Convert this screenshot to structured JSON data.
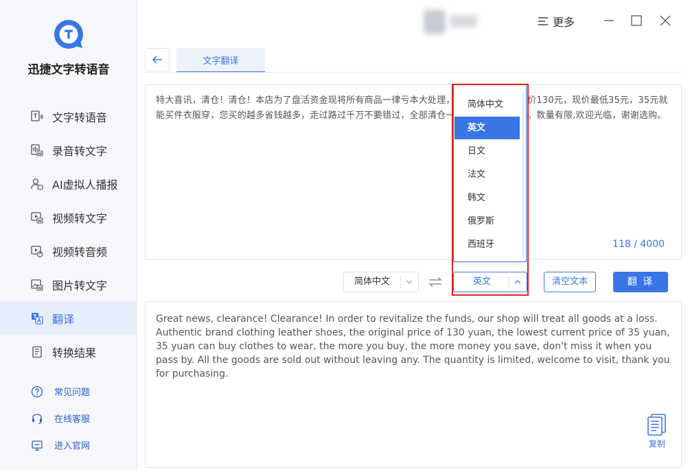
{
  "app": {
    "name": "迅捷文字转语音",
    "brand_color": "#3a75e5",
    "logo_icon": "app-logo-icon"
  },
  "sidebar": {
    "items": [
      {
        "label": "文字转语音",
        "icon": "text-to-speech-icon"
      },
      {
        "label": "录音转文字",
        "icon": "audio-to-text-icon"
      },
      {
        "label": "AI虚拟人播报",
        "icon": "virtual-anchor-icon"
      },
      {
        "label": "视频转文字",
        "icon": "video-to-text-icon"
      },
      {
        "label": "视频转音频",
        "icon": "video-to-audio-icon"
      },
      {
        "label": "图片转文字",
        "icon": "image-to-text-icon"
      },
      {
        "label": "翻译",
        "icon": "translate-icon",
        "active": true
      },
      {
        "label": "转换结果",
        "icon": "results-icon"
      }
    ],
    "help": [
      {
        "label": "常见问题",
        "icon": "question-icon"
      },
      {
        "label": "在线客服",
        "icon": "headset-icon"
      },
      {
        "label": "进入官网",
        "icon": "monitor-icon"
      }
    ]
  },
  "titlebar": {
    "more_label": "更多",
    "more_icon": "menu-icon"
  },
  "tabs": {
    "back_icon": "arrow-left-icon",
    "active_tab": "文字翻译"
  },
  "source": {
    "text": "特大喜讯，清仓！清仓！本店为了盘活资金现将所有商品一律亏本大处理，品牌服装皮鞋，原价130元，现价最低35元，35元就能买件衣服穿，您买的越多省钱越多，走过路过千万不要错过，全部清仓一件不留，全部卖光。数量有限,欢迎光临，谢谢选购。",
    "char_count": "118 / 4000"
  },
  "controls": {
    "source_language": "简体中文",
    "target_language": "英文",
    "swap_icon": "swap-arrows-icon",
    "clear_label": "清空文本",
    "translate_label": "翻 译"
  },
  "dropdown": {
    "options": [
      "简体中文",
      "英文",
      "日文",
      "法文",
      "韩文",
      "俄罗斯",
      "西班牙"
    ],
    "selected": "英文"
  },
  "result": {
    "text": "Great news, clearance! Clearance! In order to revitalize the funds, our shop will treat all goods at a loss. Authentic brand clothing leather shoes, the original price of 130 yuan, the lowest current price of 35 yuan, 35 yuan can buy clothes to wear, the more you buy, the more money you save, don't miss it when you pass by. All the goods are sold out without leaving any. The quantity is limited, welcome to visit, thank you for purchasing.",
    "copy_label": "复制",
    "copy_icon": "copy-document-icon"
  },
  "colors": {
    "accent": "#3a75e5",
    "highlight_frame": "#e02020",
    "active_nav_bg": "#e6eefb"
  }
}
